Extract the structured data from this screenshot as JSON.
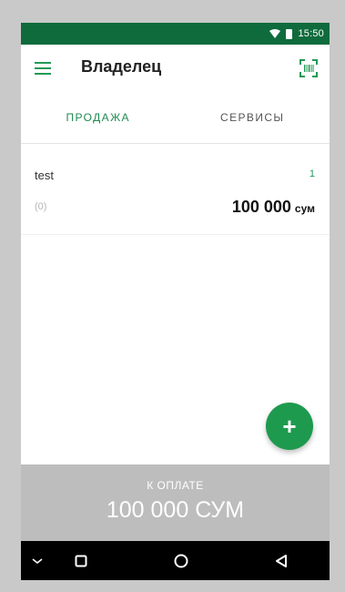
{
  "status_bar": {
    "time": "15:50"
  },
  "toolbar": {
    "title": "Владелец"
  },
  "tabs": [
    {
      "label": "ПРОДАЖА",
      "active": true
    },
    {
      "label": "СЕРВИСЫ",
      "active": false
    }
  ],
  "items": [
    {
      "name": "test",
      "quantity": "1",
      "sub": "(0)",
      "price": "100 000",
      "currency": "сум"
    }
  ],
  "pay": {
    "label": "К ОПЛАТЕ",
    "amount": "100 000 СУМ"
  },
  "colors": {
    "status_bar": "#0f6b3c",
    "accent": "#1e9a4f",
    "pay_bar": "#bdbdbd"
  },
  "icons": {
    "menu": "menu-icon",
    "scan": "barcode-scan-icon",
    "fab": "plus-icon",
    "nav": [
      "chevron-down-icon",
      "square-icon",
      "circle-icon",
      "triangle-back-icon"
    ]
  }
}
